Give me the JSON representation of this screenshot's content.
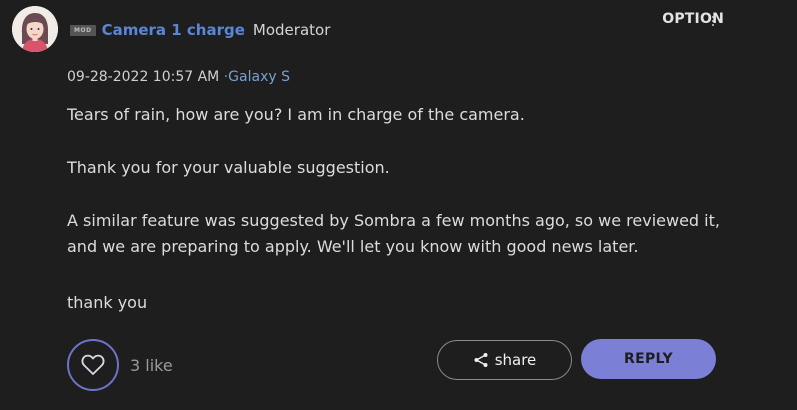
{
  "post": {
    "author": {
      "badge": "MOD",
      "name": "Camera 1 charge",
      "role": "Moderator"
    },
    "option_label": "OPTION",
    "date": "09-28-2022 10:57 AM",
    "separator": "·",
    "board": "Galaxy S",
    "paragraphs": [
      "Tears of rain, how are you? I am in charge of the camera.",
      "Thank you for your valuable suggestion.",
      "A similar feature was suggested by Sombra a few months ago, so we reviewed it, and we are preparing to apply. We'll let you know with good news later.",
      "thank you"
    ],
    "likes": "3 like",
    "share_label": "share",
    "reply_label": "REPLY"
  },
  "colors": {
    "background": "#1e1e1e",
    "author_link": "#5b86d6",
    "board_link": "#7aa0cf",
    "accent": "#7b80d6"
  },
  "icons": {
    "avatar": "avatar-illustration",
    "kebab": "more-vertical-icon",
    "like": "heart-icon",
    "share": "share-icon"
  }
}
